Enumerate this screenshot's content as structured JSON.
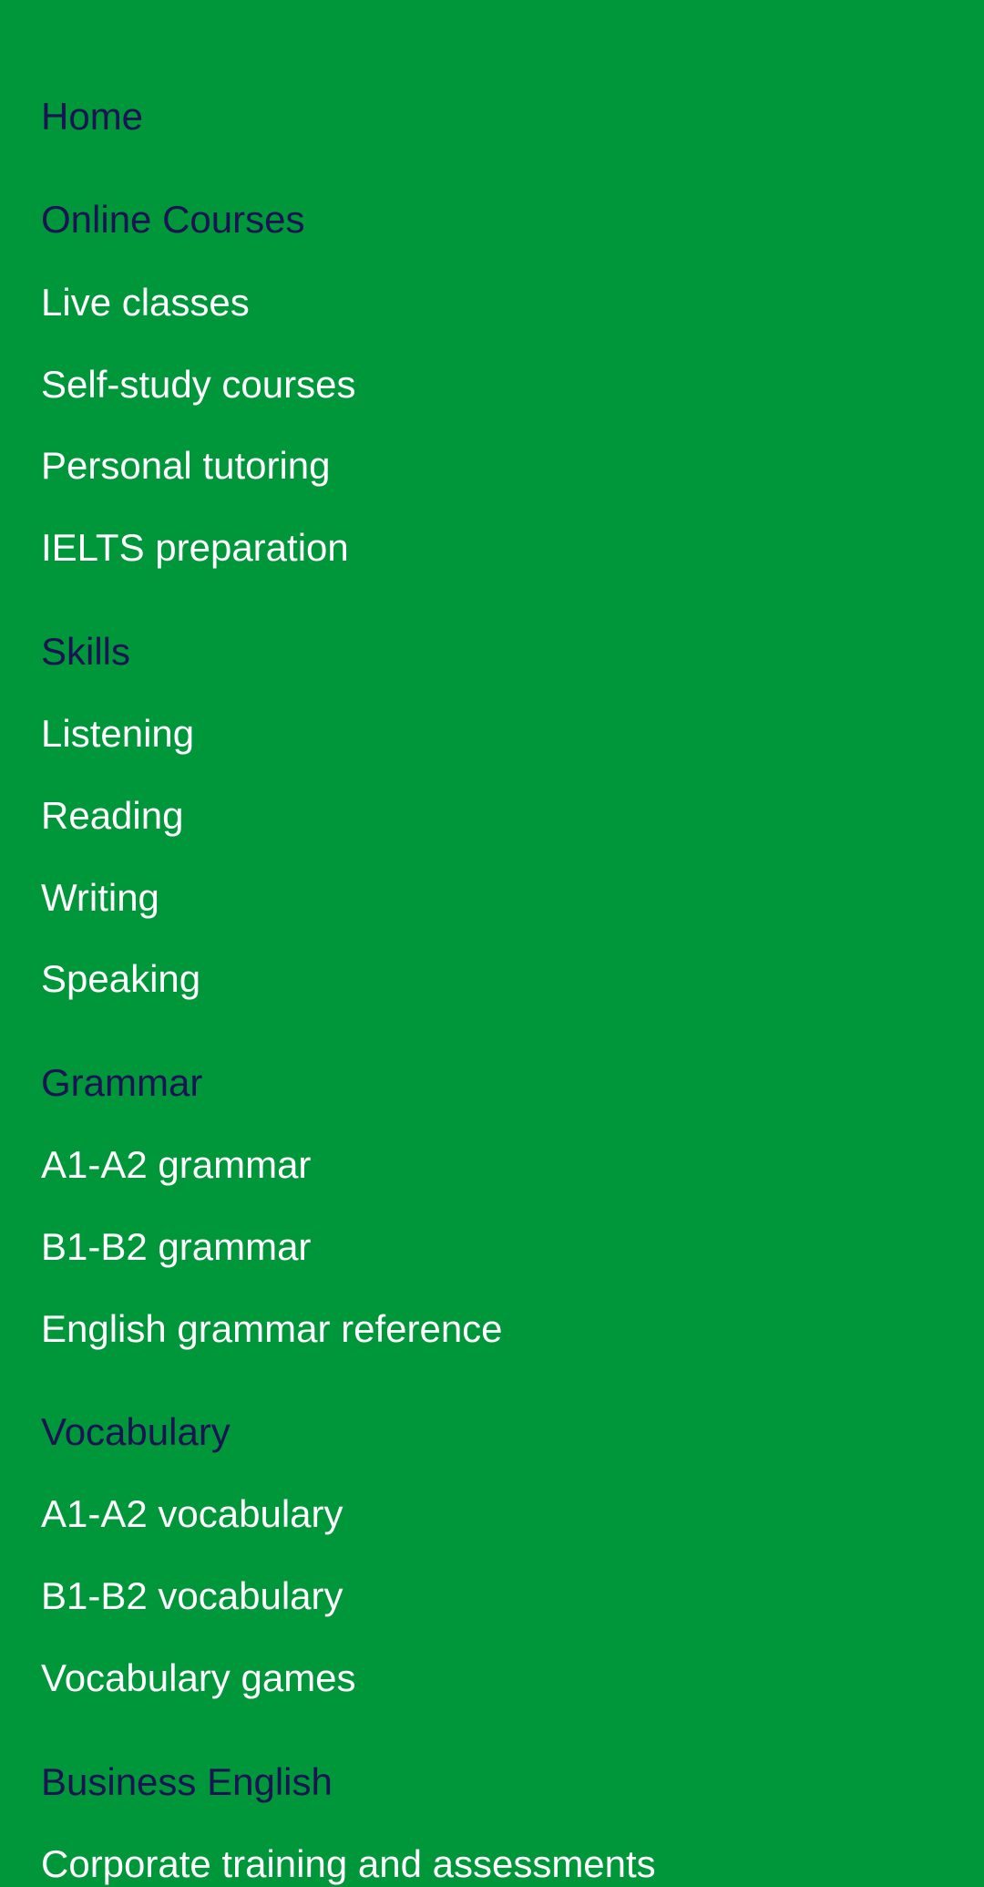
{
  "colors": {
    "background": "#00963a",
    "heading_text": "#1c1452",
    "item_text": "#ffffff"
  },
  "menu": {
    "home": "Home",
    "online_courses": {
      "heading": "Online Courses",
      "items": [
        "Live classes",
        "Self-study courses",
        "Personal tutoring",
        "IELTS preparation"
      ]
    },
    "skills": {
      "heading": "Skills",
      "items": [
        "Listening",
        "Reading",
        "Writing",
        "Speaking"
      ]
    },
    "grammar": {
      "heading": "Grammar",
      "items": [
        "A1-A2 grammar",
        "B1-B2 grammar",
        "English grammar reference"
      ]
    },
    "vocabulary": {
      "heading": "Vocabulary",
      "items": [
        "A1-A2 vocabulary",
        "B1-B2 vocabulary",
        "Vocabulary games"
      ]
    },
    "business_english": {
      "heading": "Business English",
      "items": [
        "Corporate training and assessments"
      ]
    }
  }
}
